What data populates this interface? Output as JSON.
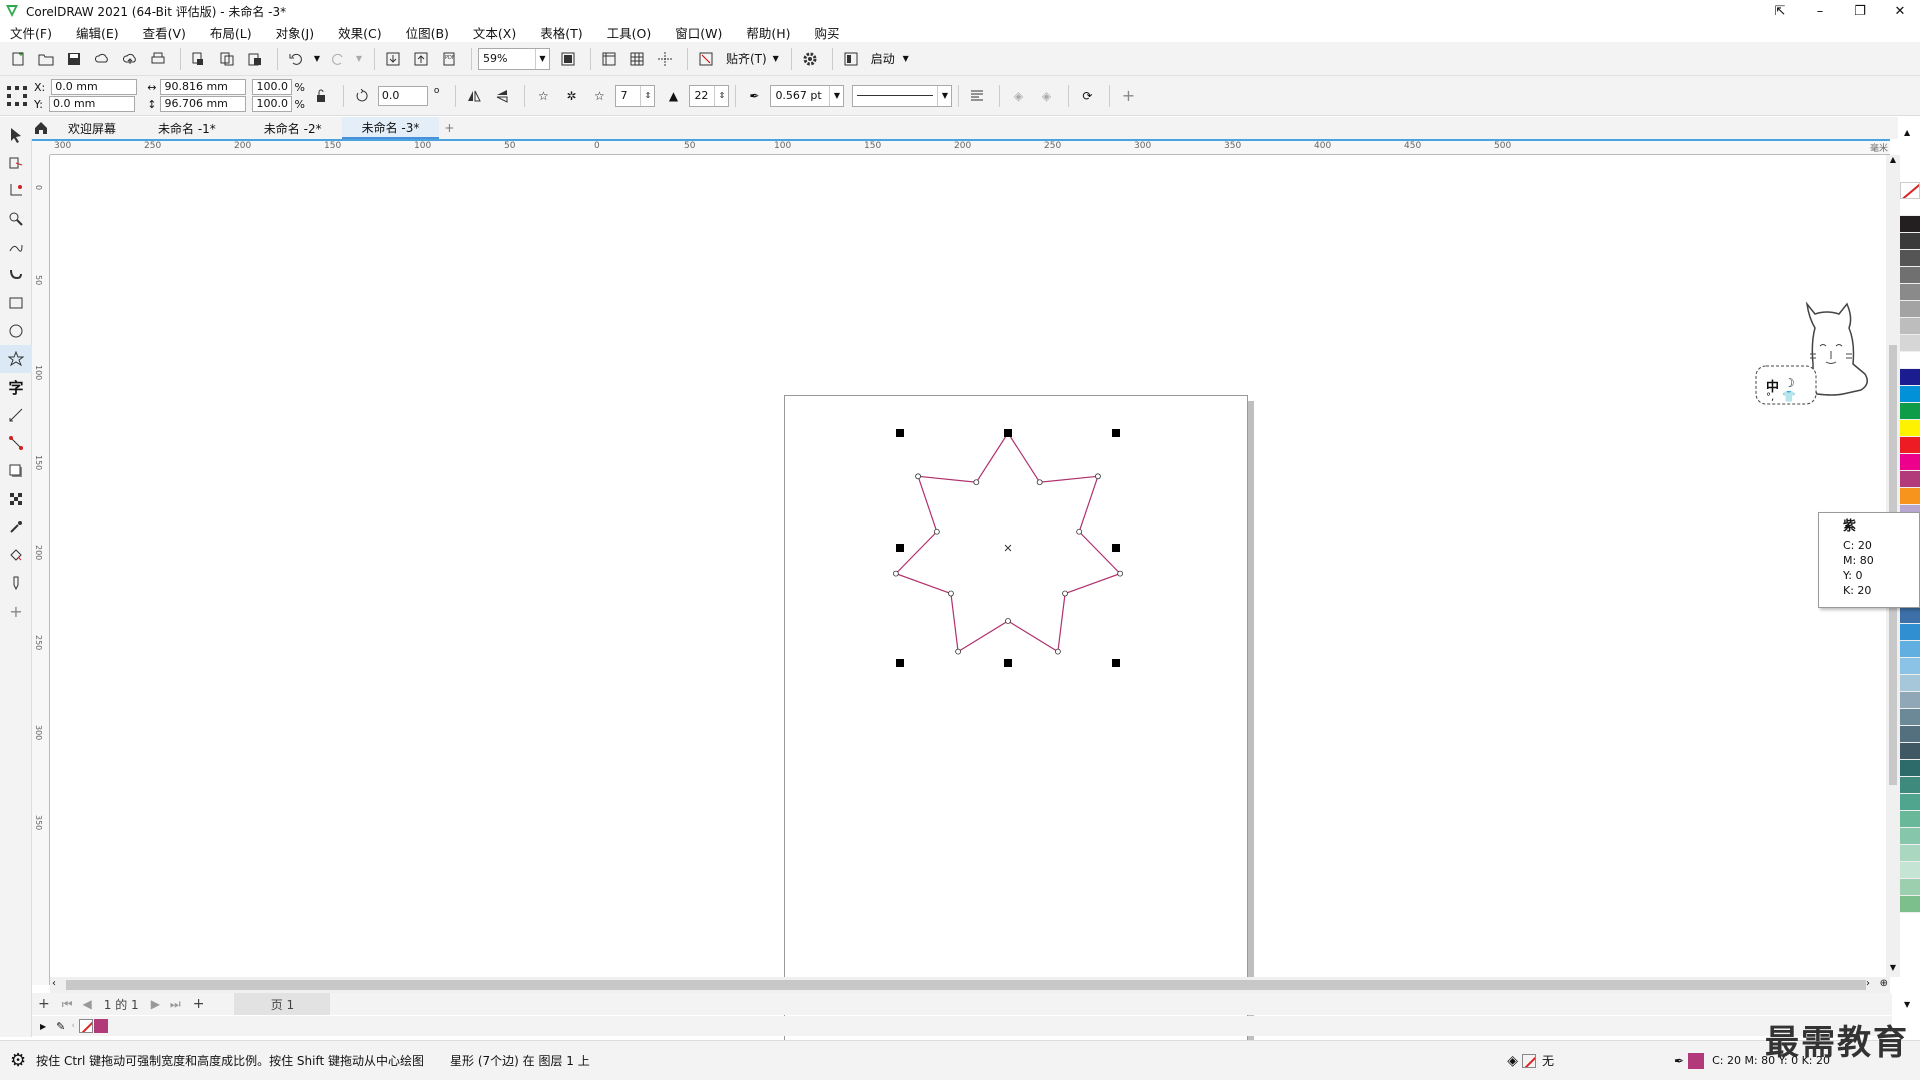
{
  "window": {
    "title": "CorelDRAW 2021 (64-Bit 评估版) - 未命名 -3*",
    "minimize": "–",
    "restore": "❐",
    "close": "✕"
  },
  "menu": [
    "文件(F)",
    "编辑(E)",
    "查看(V)",
    "布局(L)",
    "对象(J)",
    "效果(C)",
    "位图(B)",
    "文本(X)",
    "表格(T)",
    "工具(O)",
    "窗口(W)",
    "帮助(H)",
    "购买"
  ],
  "toolbar": {
    "zoom": "59%",
    "snap_label": "贴齐(T)",
    "launch_label": "启动"
  },
  "property_bar": {
    "x_label": "X:",
    "x_value": "0.0 mm",
    "y_label": "Y:",
    "y_value": "0.0 mm",
    "width_value": "90.816 mm",
    "height_value": "96.706 mm",
    "scale_w": "100.0",
    "scale_h": "100.0",
    "percent": "%",
    "rotation": "0.0",
    "degree": "o",
    "points": "7",
    "sharpness": "22",
    "outline_width": "0.567 pt"
  },
  "doc_tabs": [
    "欢迎屏幕",
    "未命名 -1*",
    "未命名 -2*",
    "未命名 -3*"
  ],
  "doc_tab_add": "+",
  "ruler_h": [
    "300",
    "250",
    "200",
    "150",
    "100",
    "50",
    "0",
    "50",
    "100",
    "150",
    "200",
    "250",
    "300",
    "350",
    "400",
    "450",
    "500"
  ],
  "ruler_unit": "毫米",
  "ruler_v": [
    "0",
    "50",
    "100",
    "150",
    "200",
    "250",
    "300",
    "350"
  ],
  "page_nav": {
    "page_count": "1 的 1",
    "page_tab": "页 1",
    "add": "+"
  },
  "tooltip": {
    "name": "紫",
    "c": "C:   20",
    "m": "M:   80",
    "y": "Y:    0",
    "k": "K:   20"
  },
  "ime_widget": {
    "label": "中",
    "moon": "☽",
    "punct": "°,"
  },
  "status": {
    "hint": "按住 Ctrl 键拖动可强制宽度和高度成比例。按住 Shift 键拖动从中心绘图",
    "object_info": "星形 (7个边) 在 图层 1 上",
    "fill_label": "无",
    "outline_cmyk": "C: 20 M: 80 Y: 0 K: 20"
  },
  "watermark": "最需教育",
  "colors": {
    "star_outline": "#b0306e",
    "accent": "#4aa3df",
    "outline_swatch": "#b33a7a"
  },
  "palette": [
    "#ffffff",
    "#231f20",
    "#3a3a3a",
    "#555555",
    "#707070",
    "#8a8a8a",
    "#a3a3a3",
    "#bdbdbd",
    "#d6d6d6",
    "#ffffff",
    "#1b1c8f",
    "#0091d8",
    "#0f9c48",
    "#fff200",
    "#ed1c24",
    "#ec008c",
    "#b33a7a",
    "#f7941d",
    "#b7a7d1",
    "#9e8fc0",
    "#877aae",
    "#6e6b9c",
    "#5a5a8c",
    "#464e77",
    "#3d6fa8",
    "#2f8fd0",
    "#61aee0",
    "#8bc3e6",
    "#a6c7d9",
    "#8fa7b7",
    "#6c8998",
    "#546f7e",
    "#3f5864",
    "#2d6a6a",
    "#3e8a7c",
    "#50a58e",
    "#6ab89a",
    "#86c7ab",
    "#a9d7c0",
    "#c6e4d4",
    "#9ccfad",
    "#7cbf8c"
  ]
}
